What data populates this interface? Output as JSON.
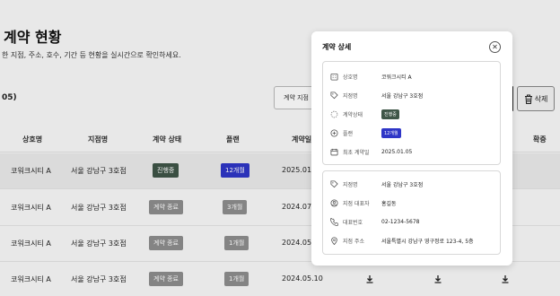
{
  "page": {
    "title": "계약 현황",
    "subtitle": "한 지점, 주소, 호수, 기간 등 현황을 실시간으로 확인하세요.",
    "count": "05)",
    "filter_label": "계약 지점",
    "delete_label": "삭제"
  },
  "table": {
    "headers": [
      "상호명",
      "지점명",
      "계약 상태",
      "플랜",
      "계약일",
      "확증"
    ],
    "rows": [
      {
        "company": "코워크시티 A",
        "branch": "서울 강남구 3호점",
        "status": "진행중",
        "status_color": "#3f5648",
        "plan": "12개월",
        "plan_color": "#2f36c7",
        "date": "2025.01",
        "selected": true
      },
      {
        "company": "코워크시티 A",
        "branch": "서울 강남구 3호점",
        "status": "계약 종료",
        "status_color": "#8e8e8e",
        "plan": "3개월",
        "plan_color": "#8e8e8e",
        "date": "2024.07",
        "selected": false
      },
      {
        "company": "코워크시티 A",
        "branch": "서울 강남구 3호점",
        "status": "계약 종료",
        "status_color": "#8e8e8e",
        "plan": "1개월",
        "plan_color": "#8e8e8e",
        "date": "2024.05",
        "selected": false
      },
      {
        "company": "코워크시티 A",
        "branch": "서울 강남구 3호점",
        "status": "계약 종료",
        "status_color": "#8e8e8e",
        "plan": "1개월",
        "plan_color": "#8e8e8e",
        "date": "2024.05.10",
        "selected": false
      }
    ]
  },
  "modal": {
    "title": "계약 상세",
    "close_icon": "close-circle-icon",
    "contract": [
      {
        "icon": "building-icon",
        "label": "상호명",
        "value": "코워크시티 A"
      },
      {
        "icon": "tag-icon",
        "label": "지점명",
        "value": "서울 강남구 3호점"
      },
      {
        "icon": "loader-icon",
        "label": "계약상태",
        "badge": "진행중",
        "badge_color": "#3f5648"
      },
      {
        "icon": "plus-circle-icon",
        "label": "플랜",
        "badge": "12개월",
        "badge_color": "#2f36c7"
      },
      {
        "icon": "calendar-icon",
        "label": "최초 계약일",
        "value": "2025.01.05"
      }
    ],
    "branch": [
      {
        "icon": "tag-icon",
        "label": "지점명",
        "value": "서울 강남구 3호점"
      },
      {
        "icon": "user-icon",
        "label": "지점 대표자",
        "value": "홍길동"
      },
      {
        "icon": "phone-icon",
        "label": "대표번호",
        "value": "02-1234-5678"
      },
      {
        "icon": "map-pin-icon",
        "label": "지점 주소",
        "value": "서울특별시 강남구 영구정로 123-4, 5층"
      }
    ]
  }
}
